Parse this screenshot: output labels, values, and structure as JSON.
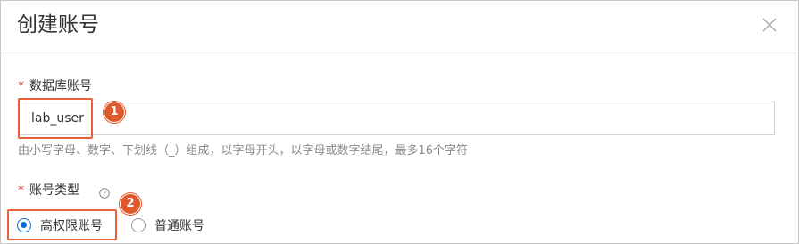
{
  "dialog": {
    "title": "创建账号"
  },
  "form": {
    "db_account": {
      "required_mark": "*",
      "label": "数据库账号",
      "value": "lab_user",
      "hint": "由小写字母、数字、下划线（_）组成，以字母开头，以字母或数字结尾，最多16个字符"
    },
    "account_type": {
      "required_mark": "*",
      "label": "账号类型",
      "options": [
        {
          "label": "高权限账号",
          "checked": true
        },
        {
          "label": "普通账号",
          "checked": false
        }
      ]
    }
  },
  "annotations": [
    "1",
    "2"
  ],
  "colors": {
    "accent": "#0b6fd0",
    "annotation": "#e0592d",
    "required": "#d93026"
  },
  "icons": {
    "close": "close-icon",
    "help": "help-circle-icon"
  }
}
